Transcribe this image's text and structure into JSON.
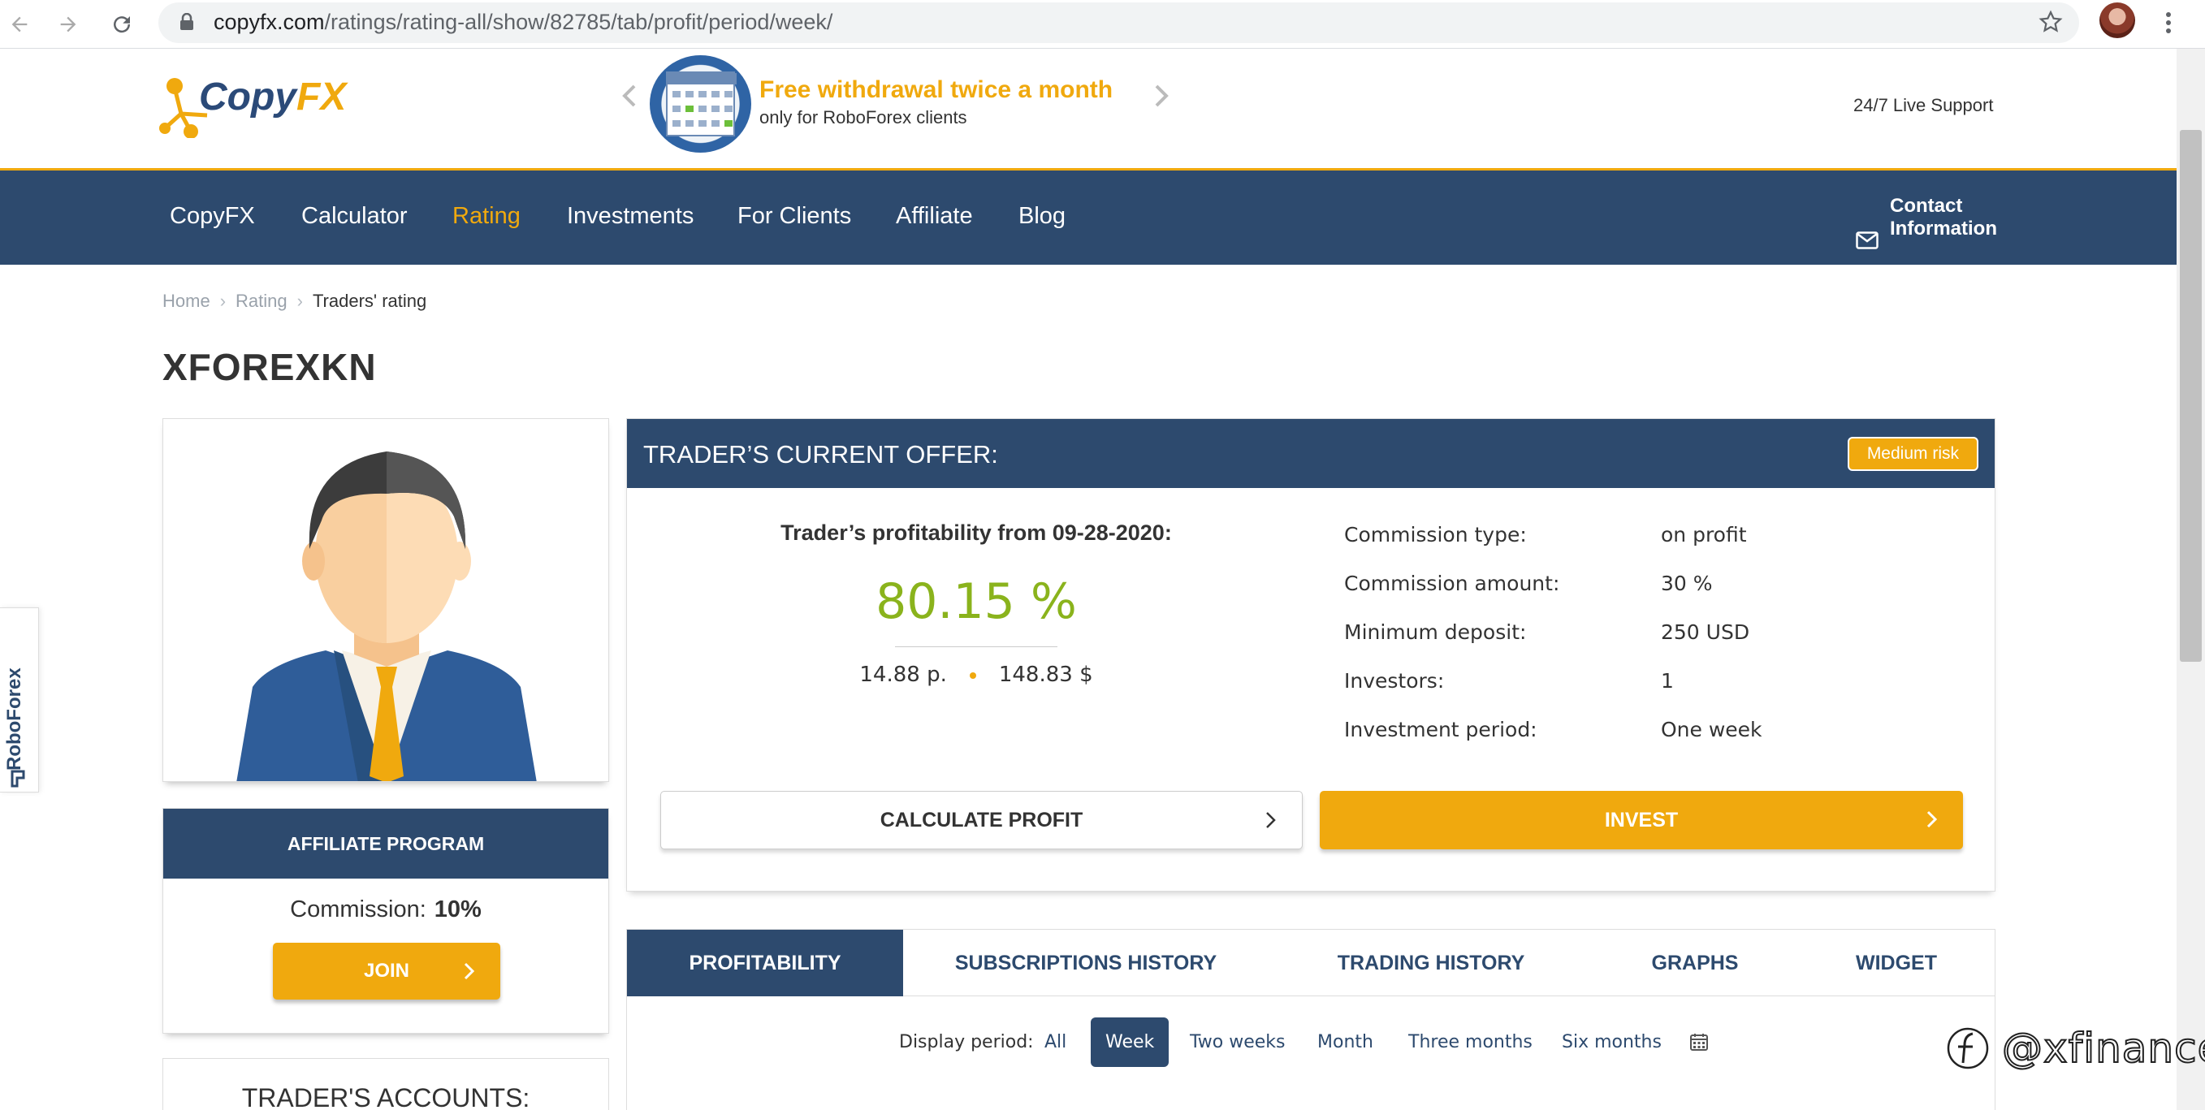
{
  "browser": {
    "url_domain": "copyfx.com",
    "url_path": "/ratings/rating-all/show/82785/tab/profit/period/week/"
  },
  "header": {
    "logo_part1": "Copy",
    "logo_part2": "FX",
    "promo_title": "Free withdrawal twice a month",
    "promo_subtitle": "only for RoboForex clients",
    "support": "24/7 Live Support"
  },
  "nav": {
    "items": [
      {
        "label": "CopyFX"
      },
      {
        "label": "Calculator"
      },
      {
        "label": "Rating"
      },
      {
        "label": "Investments"
      },
      {
        "label": "For Clients"
      },
      {
        "label": "Affiliate"
      },
      {
        "label": "Blog"
      }
    ],
    "active": "Rating",
    "contact": "Contact\nInformation"
  },
  "side_tab": "RoboForex",
  "breadcrumb": {
    "home": "Home",
    "rating": "Rating",
    "current": "Traders' rating"
  },
  "page_title": "XFOREXKN",
  "affiliate": {
    "title": "AFFILIATE PROGRAM",
    "commission_label": "Commission:",
    "commission_value": "10%",
    "join_label": "JOIN"
  },
  "accounts_title": "TRADER'S ACCOUNTS:",
  "offer": {
    "title": "TRADER’S CURRENT OFFER:",
    "risk": "Medium risk",
    "profitability_label": "Trader’s profitability from 09-28-2020:",
    "profitability_value": "80.15 %",
    "points": "14.88 p.",
    "amount": "148.83 $",
    "terms": [
      {
        "key": "Commission type:",
        "value": "on profit"
      },
      {
        "key": "Commission amount:",
        "value": "30 %"
      },
      {
        "key": "Minimum deposit:",
        "value": "250 USD"
      },
      {
        "key": "Investors:",
        "value": "1"
      },
      {
        "key": "Investment period:",
        "value": "One week"
      }
    ],
    "calc_label": "CALCULATE PROFIT",
    "invest_label": "INVEST"
  },
  "tabs": [
    {
      "label": "PROFITABILITY"
    },
    {
      "label": "SUBSCRIPTIONS HISTORY"
    },
    {
      "label": "TRADING HISTORY"
    },
    {
      "label": "GRAPHS"
    },
    {
      "label": "WIDGET"
    }
  ],
  "active_tab": "PROFITABILITY",
  "period": {
    "label": "Display period:",
    "options": [
      {
        "label": "All"
      },
      {
        "label": "Week"
      },
      {
        "label": "Two weeks"
      },
      {
        "label": "Month"
      },
      {
        "label": "Three months"
      },
      {
        "label": "Six months"
      }
    ],
    "active": "Week"
  },
  "watermark": "@xfinance",
  "colors": {
    "navy": "#2d4a6e",
    "accent": "#f0a90e",
    "profit_green": "#8ab31c"
  }
}
